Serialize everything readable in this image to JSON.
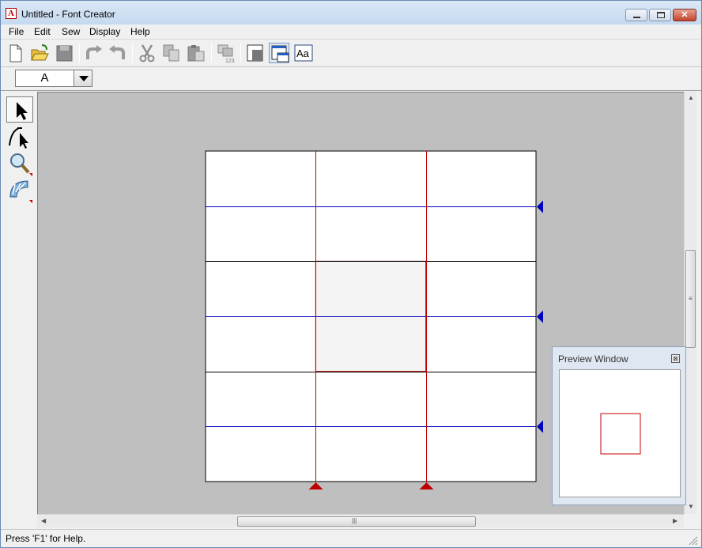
{
  "window": {
    "title": "Untitled - Font Creator",
    "app_icon_glyph": "A"
  },
  "menu": {
    "items": [
      "File",
      "Edit",
      "Sew",
      "Display",
      "Help"
    ]
  },
  "toolbar": {
    "buttons": [
      "new-file-icon",
      "open-folder-icon",
      "save-icon",
      "undo-icon",
      "redo-icon",
      "cut-icon",
      "copy-icon",
      "paste-icon",
      "renumber-icon",
      "frame-icon",
      "window-layout-icon",
      "font-preview-icon"
    ],
    "font_preview_label": "Aa"
  },
  "character_combo": {
    "value": "A"
  },
  "tools": [
    "select-arrow-icon",
    "node-edit-icon",
    "zoom-magnifier-icon",
    "stitch-tool-icon"
  ],
  "canvas": {
    "grid_color": "#c00000",
    "guide_color": "#0000c0",
    "grid_columns": 3,
    "grid_rows": 6,
    "highlighted_cell_fill": "#f4f4f4"
  },
  "preview": {
    "title": "Preview Window",
    "close_glyph": "⊠"
  },
  "status": {
    "text": "Press 'F1' for Help."
  }
}
